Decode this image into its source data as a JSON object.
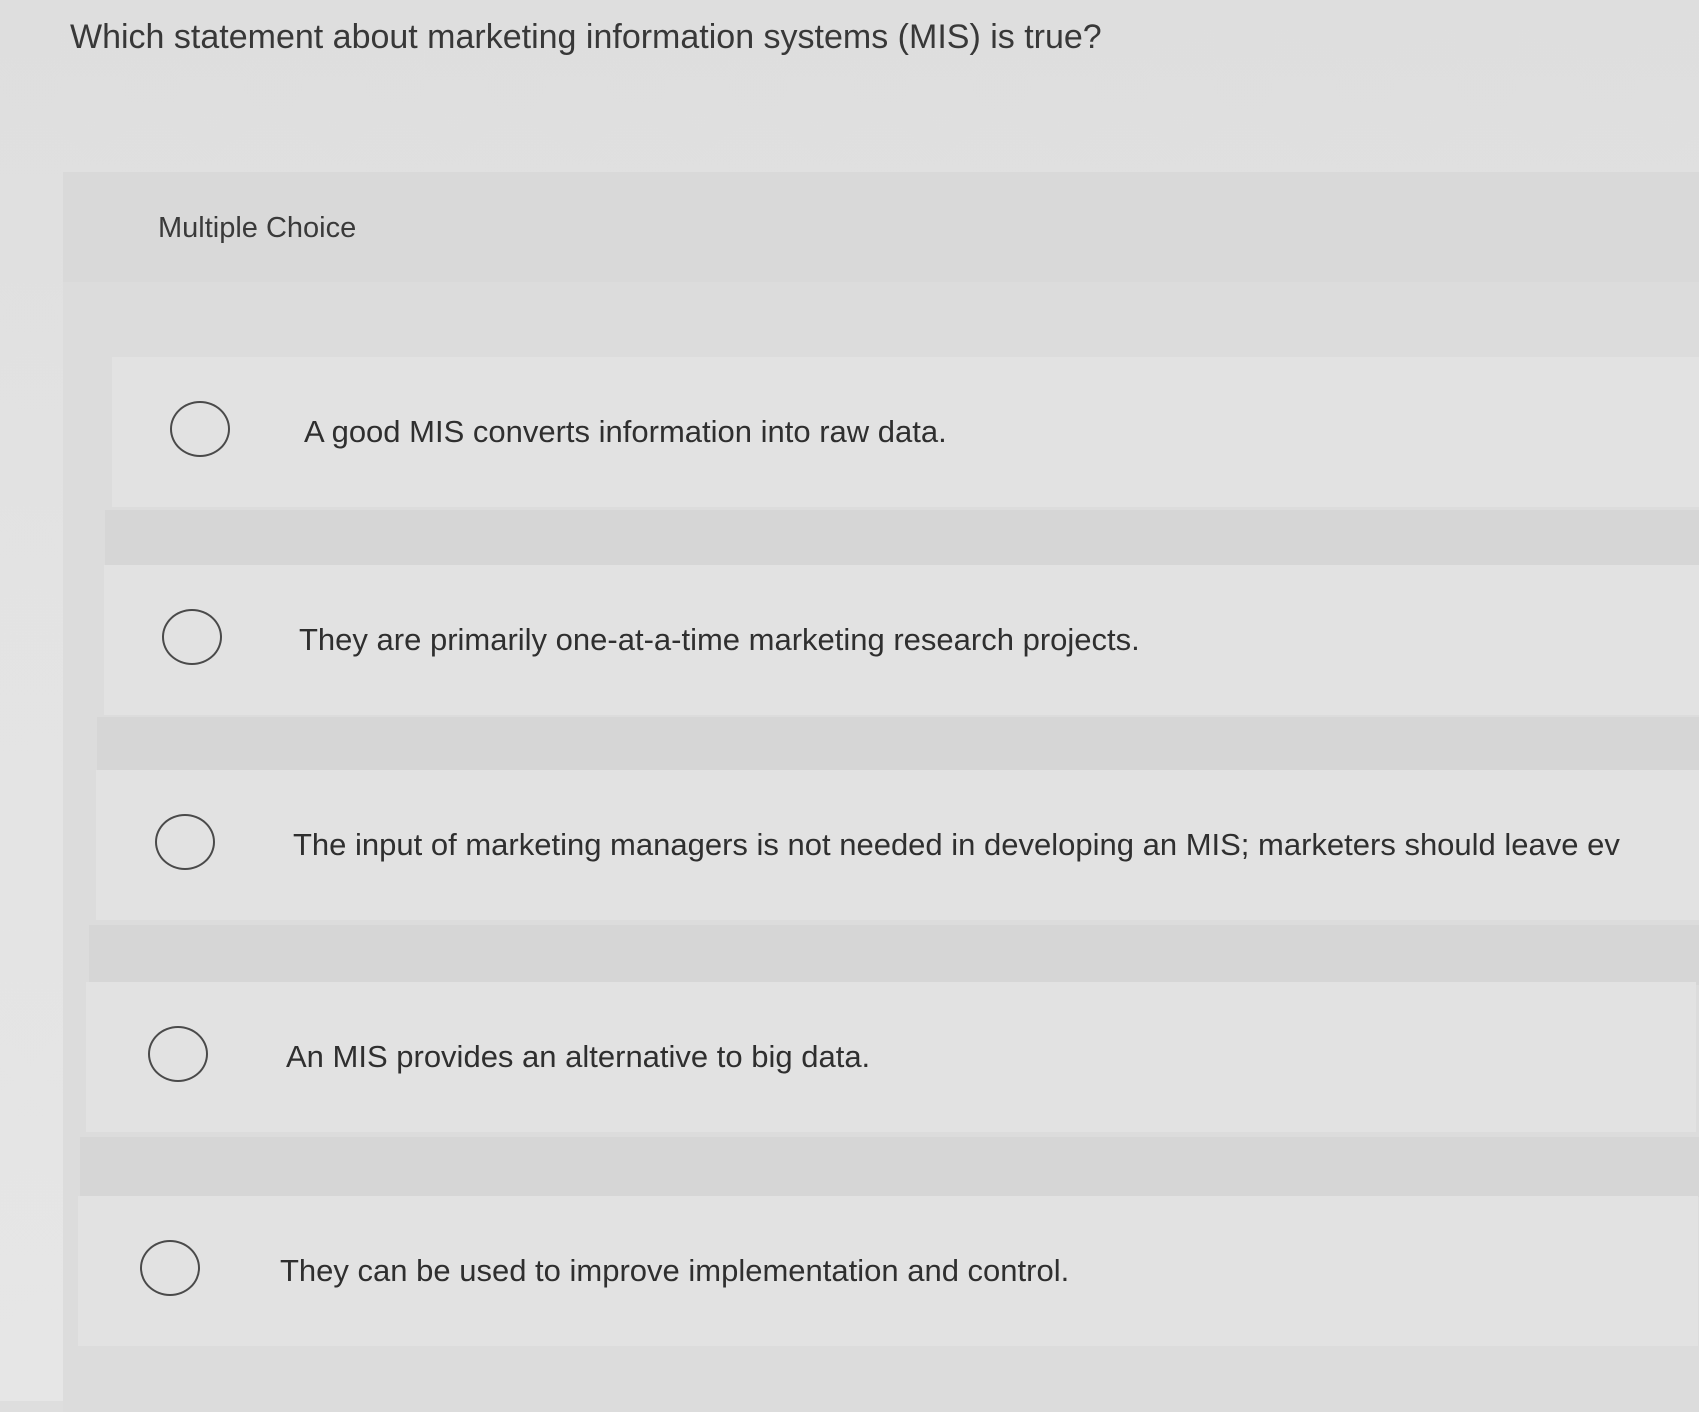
{
  "question": {
    "text": "Which statement about marketing information systems (MIS) is true?"
  },
  "section": {
    "label": "Multiple Choice"
  },
  "choices": [
    {
      "text": "A good MIS converts information into raw data.",
      "selected": false
    },
    {
      "text": "They are primarily one-at-a-time marketing research projects.",
      "selected": false
    },
    {
      "text": "The input of marketing managers is not needed in developing an MIS; marketers should leave ev",
      "selected": false
    },
    {
      "text": "An MIS provides an alternative to big data.",
      "selected": false
    },
    {
      "text": "They can be used to improve implementation and control.",
      "selected": false
    }
  ]
}
